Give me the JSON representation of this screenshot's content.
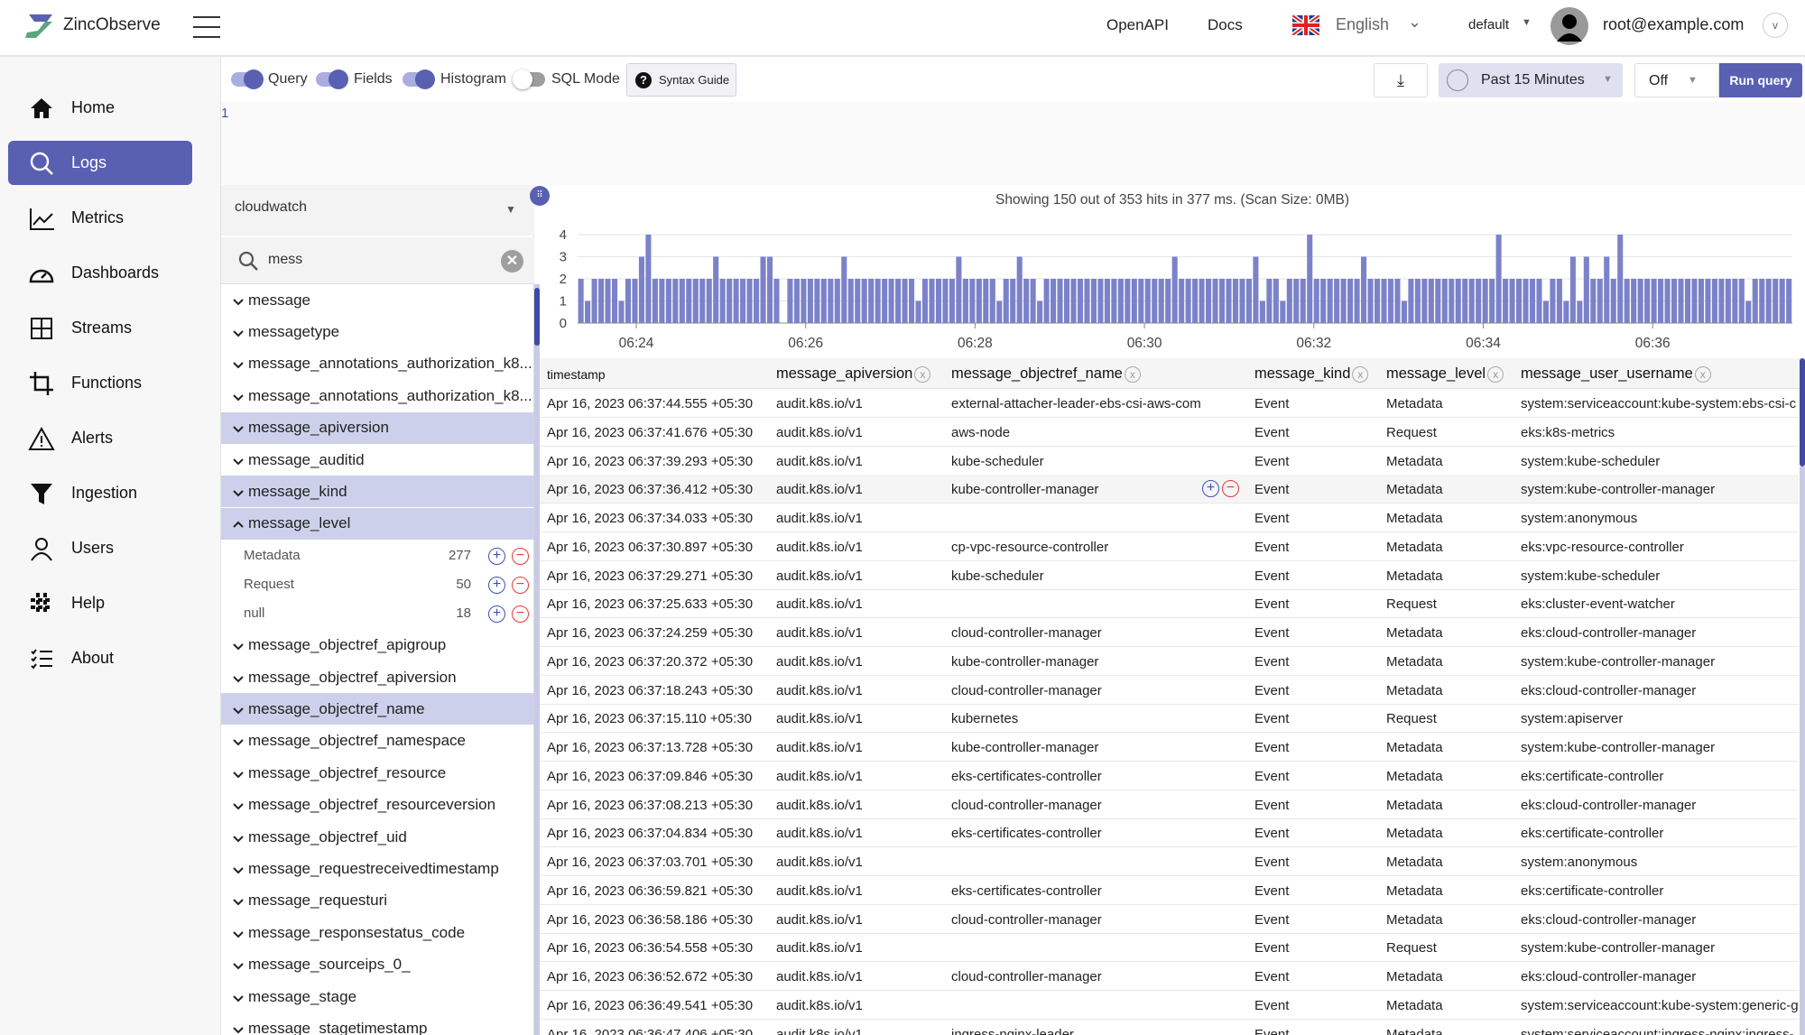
{
  "header": {
    "app_name": "ZincObserve",
    "links": [
      "OpenAPI",
      "Docs"
    ],
    "language": "English",
    "org": "default",
    "user": "root@example.com"
  },
  "nav": {
    "items": [
      {
        "label": "Home",
        "icon": "home-icon"
      },
      {
        "label": "Logs",
        "icon": "search-icon",
        "active": true
      },
      {
        "label": "Metrics",
        "icon": "chart-line-icon"
      },
      {
        "label": "Dashboards",
        "icon": "gauge-icon"
      },
      {
        "label": "Streams",
        "icon": "grid-icon"
      },
      {
        "label": "Functions",
        "icon": "crop-icon"
      },
      {
        "label": "Alerts",
        "icon": "warning-icon"
      },
      {
        "label": "Ingestion",
        "icon": "filter-icon"
      },
      {
        "label": "Users",
        "icon": "user-icon"
      },
      {
        "label": "Help",
        "icon": "slack-icon"
      },
      {
        "label": "About",
        "icon": "checklist-icon"
      }
    ]
  },
  "toolbar": {
    "toggles": [
      {
        "label": "Query",
        "on": true
      },
      {
        "label": "Fields",
        "on": true
      },
      {
        "label": "Histogram",
        "on": true
      },
      {
        "label": "SQL Mode",
        "on": false
      }
    ],
    "syntax_guide": "Syntax Guide",
    "time_range": "Past 15 Minutes",
    "refresh": "Off",
    "run_query": "Run query"
  },
  "editor": {
    "line_number": "1",
    "query": ""
  },
  "fields": {
    "stream": "cloudwatch",
    "search_value": "mess",
    "items": [
      {
        "name": "message"
      },
      {
        "name": "messagetype"
      },
      {
        "name": "message_annotations_authorization_k8..."
      },
      {
        "name": "message_annotations_authorization_k8..."
      },
      {
        "name": "message_apiversion",
        "selected": true
      },
      {
        "name": "message_auditid"
      },
      {
        "name": "message_kind",
        "selected": true
      },
      {
        "name": "message_level",
        "selected": true,
        "expanded": true,
        "values": [
          {
            "value": "Metadata",
            "count": "277"
          },
          {
            "value": "Request",
            "count": "50"
          },
          {
            "value": "null",
            "count": "18"
          }
        ]
      },
      {
        "name": "message_objectref_apigroup"
      },
      {
        "name": "message_objectref_apiversion"
      },
      {
        "name": "message_objectref_name",
        "selected": true
      },
      {
        "name": "message_objectref_namespace"
      },
      {
        "name": "message_objectref_resource"
      },
      {
        "name": "message_objectref_resourceversion"
      },
      {
        "name": "message_objectref_uid"
      },
      {
        "name": "message_requestreceivedtimestamp"
      },
      {
        "name": "message_requesturi"
      },
      {
        "name": "message_responsestatus_code"
      },
      {
        "name": "message_sourceips_0_"
      },
      {
        "name": "message_stage"
      },
      {
        "name": "message_stagetimestamp"
      }
    ]
  },
  "results": {
    "summary": "Showing 150 out of 353 hits in 377 ms. (Scan Size: 0MB)",
    "columns": [
      "timestamp",
      "message_apiversion",
      "message_objectref_name",
      "message_kind",
      "message_level",
      "message_user_username"
    ],
    "rows": [
      [
        "Apr 16, 2023 06:37:44.555 +05:30",
        "audit.k8s.io/v1",
        "external-attacher-leader-ebs-csi-aws-com",
        "Event",
        "Metadata",
        "system:serviceaccount:kube-system:ebs-csi-c"
      ],
      [
        "Apr 16, 2023 06:37:41.676 +05:30",
        "audit.k8s.io/v1",
        "aws-node",
        "Event",
        "Request",
        "eks:k8s-metrics"
      ],
      [
        "Apr 16, 2023 06:37:39.293 +05:30",
        "audit.k8s.io/v1",
        "kube-scheduler",
        "Event",
        "Metadata",
        "system:kube-scheduler"
      ],
      [
        "Apr 16, 2023 06:37:36.412 +05:30",
        "audit.k8s.io/v1",
        "kube-controller-manager",
        "Event",
        "Metadata",
        "system:kube-controller-manager"
      ],
      [
        "Apr 16, 2023 06:37:34.033 +05:30",
        "audit.k8s.io/v1",
        "",
        "Event",
        "Metadata",
        "system:anonymous"
      ],
      [
        "Apr 16, 2023 06:37:30.897 +05:30",
        "audit.k8s.io/v1",
        "cp-vpc-resource-controller",
        "Event",
        "Metadata",
        "eks:vpc-resource-controller"
      ],
      [
        "Apr 16, 2023 06:37:29.271 +05:30",
        "audit.k8s.io/v1",
        "kube-scheduler",
        "Event",
        "Metadata",
        "system:kube-scheduler"
      ],
      [
        "Apr 16, 2023 06:37:25.633 +05:30",
        "audit.k8s.io/v1",
        "",
        "Event",
        "Request",
        "eks:cluster-event-watcher"
      ],
      [
        "Apr 16, 2023 06:37:24.259 +05:30",
        "audit.k8s.io/v1",
        "cloud-controller-manager",
        "Event",
        "Metadata",
        "eks:cloud-controller-manager"
      ],
      [
        "Apr 16, 2023 06:37:20.372 +05:30",
        "audit.k8s.io/v1",
        "kube-controller-manager",
        "Event",
        "Metadata",
        "system:kube-controller-manager"
      ],
      [
        "Apr 16, 2023 06:37:18.243 +05:30",
        "audit.k8s.io/v1",
        "cloud-controller-manager",
        "Event",
        "Metadata",
        "eks:cloud-controller-manager"
      ],
      [
        "Apr 16, 2023 06:37:15.110 +05:30",
        "audit.k8s.io/v1",
        "kubernetes",
        "Event",
        "Request",
        "system:apiserver"
      ],
      [
        "Apr 16, 2023 06:37:13.728 +05:30",
        "audit.k8s.io/v1",
        "kube-controller-manager",
        "Event",
        "Metadata",
        "system:kube-controller-manager"
      ],
      [
        "Apr 16, 2023 06:37:09.846 +05:30",
        "audit.k8s.io/v1",
        "eks-certificates-controller",
        "Event",
        "Metadata",
        "eks:certificate-controller"
      ],
      [
        "Apr 16, 2023 06:37:08.213 +05:30",
        "audit.k8s.io/v1",
        "cloud-controller-manager",
        "Event",
        "Metadata",
        "eks:cloud-controller-manager"
      ],
      [
        "Apr 16, 2023 06:37:04.834 +05:30",
        "audit.k8s.io/v1",
        "eks-certificates-controller",
        "Event",
        "Metadata",
        "eks:certificate-controller"
      ],
      [
        "Apr 16, 2023 06:37:03.701 +05:30",
        "audit.k8s.io/v1",
        "",
        "Event",
        "Metadata",
        "system:anonymous"
      ],
      [
        "Apr 16, 2023 06:36:59.821 +05:30",
        "audit.k8s.io/v1",
        "eks-certificates-controller",
        "Event",
        "Metadata",
        "eks:certificate-controller"
      ],
      [
        "Apr 16, 2023 06:36:58.186 +05:30",
        "audit.k8s.io/v1",
        "cloud-controller-manager",
        "Event",
        "Metadata",
        "eks:cloud-controller-manager"
      ],
      [
        "Apr 16, 2023 06:36:54.558 +05:30",
        "audit.k8s.io/v1",
        "",
        "Event",
        "Request",
        "system:kube-controller-manager"
      ],
      [
        "Apr 16, 2023 06:36:52.672 +05:30",
        "audit.k8s.io/v1",
        "cloud-controller-manager",
        "Event",
        "Metadata",
        "eks:cloud-controller-manager"
      ],
      [
        "Apr 16, 2023 06:36:49.541 +05:30",
        "audit.k8s.io/v1",
        "",
        "Event",
        "Metadata",
        "system:serviceaccount:kube-system:generic-g"
      ],
      [
        "Apr 16, 2023 06:36:47.406 +05:30",
        "audit.k8s.io/v1",
        "ingress-nginx-leader",
        "Event",
        "Metadata",
        "system:serviceaccount:ingress-nginx:ingress-"
      ]
    ]
  },
  "chart_data": {
    "type": "bar",
    "title": "",
    "xlabel": "",
    "ylabel": "",
    "ylim": [
      0,
      4
    ],
    "grid": true,
    "yticks": [
      "0",
      "1",
      "2",
      "3",
      "4"
    ],
    "xticks": [
      "06:24",
      "06:26",
      "06:28",
      "06:30",
      "06:32",
      "06:34",
      "06:36"
    ],
    "values": [
      2,
      1,
      2,
      2,
      2,
      2,
      1,
      2,
      2,
      3,
      4,
      2,
      2,
      2,
      2,
      2,
      2,
      2,
      2,
      2,
      3,
      2,
      2,
      2,
      2,
      2,
      2,
      3,
      3,
      2,
      0,
      2,
      2,
      2,
      2,
      2,
      2,
      2,
      2,
      3,
      2,
      2,
      2,
      2,
      2,
      2,
      2,
      2,
      2,
      2,
      1,
      2,
      2,
      2,
      2,
      2,
      3,
      2,
      2,
      2,
      2,
      2,
      1,
      2,
      2,
      3,
      2,
      2,
      1,
      2,
      2,
      2,
      2,
      2,
      2,
      2,
      2,
      2,
      2,
      2,
      2,
      2,
      2,
      2,
      2,
      2,
      2,
      2,
      3,
      2,
      2,
      2,
      2,
      2,
      2,
      2,
      2,
      2,
      2,
      2,
      3,
      1,
      2,
      2,
      1,
      2,
      2,
      2,
      4,
      2,
      2,
      2,
      2,
      2,
      2,
      2,
      3,
      2,
      2,
      2,
      2,
      2,
      1,
      2,
      2,
      2,
      2,
      2,
      2,
      2,
      2,
      2,
      2,
      2,
      2,
      2,
      4,
      2,
      2,
      2,
      2,
      2,
      2,
      1,
      2,
      2,
      1,
      3,
      1,
      3,
      2,
      2,
      3,
      2,
      4,
      2,
      2,
      2,
      2,
      2,
      2,
      2,
      2,
      2,
      2,
      2,
      2,
      2,
      2,
      2,
      2,
      2,
      2,
      1,
      2,
      2,
      2,
      2,
      2,
      2
    ],
    "color": "#7b82c9"
  },
  "colors": {
    "accent": "#5960b2",
    "selected_field": "#cdd0ea",
    "include": "#3f51b5",
    "exclude": "#e53935"
  }
}
